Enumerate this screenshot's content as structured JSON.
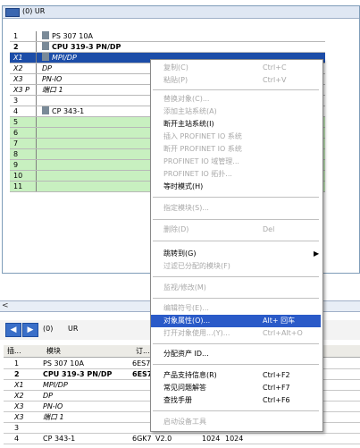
{
  "rack": {
    "title": "(0) UR",
    "rows": [
      {
        "slot": "1",
        "module": "PS 307 10A",
        "style": "normal"
      },
      {
        "slot": "2",
        "module": "CPU 319-3 PN/DP",
        "style": "bold"
      },
      {
        "slot": "X1",
        "module": "MPI/DP",
        "style": "sel"
      },
      {
        "slot": "X2",
        "module": "DP",
        "style": "italic"
      },
      {
        "slot": "X3",
        "module": "PN-IO",
        "style": "italic"
      },
      {
        "slot": "X3 P",
        "module": "端口 1",
        "style": "italic"
      },
      {
        "slot": "3",
        "module": "",
        "style": "normal"
      },
      {
        "slot": "4",
        "module": "CP 343-1",
        "style": "normal"
      },
      {
        "slot": "5",
        "module": "",
        "style": "green"
      },
      {
        "slot": "6",
        "module": "",
        "style": "green"
      },
      {
        "slot": "7",
        "module": "",
        "style": "green"
      },
      {
        "slot": "8",
        "module": "",
        "style": "green"
      },
      {
        "slot": "9",
        "module": "",
        "style": "green"
      },
      {
        "slot": "10",
        "module": "",
        "style": "green"
      },
      {
        "slot": "11",
        "module": "",
        "style": "green"
      }
    ]
  },
  "lower": {
    "title": "(0)",
    "title2": "UR",
    "headers": {
      "slot": "插...",
      "module": "模块",
      "order": "订..."
    },
    "rows": [
      {
        "slot": "1",
        "module": "PS 307 10A",
        "order": "6ES7"
      },
      {
        "slot": "2",
        "module": "CPU 319-3 PN/DP",
        "order": "6ES7"
      },
      {
        "slot": "X1",
        "module": "MPI/DP",
        "order": ""
      },
      {
        "slot": "X2",
        "module": "DP",
        "order": ""
      },
      {
        "slot": "X3",
        "module": "PN-IO",
        "order": ""
      },
      {
        "slot": "X3",
        "module": "端口 1",
        "order": ""
      },
      {
        "slot": "3",
        "module": "",
        "order": ""
      },
      {
        "slot": "4",
        "module": "CP 343-1",
        "order": "6GK7",
        "v": "V2.0",
        "a": "1024",
        "b": "1024"
      }
    ]
  },
  "menu": {
    "items": [
      {
        "label": "复制(C)",
        "shortcut": "Ctrl+C",
        "state": "disabled"
      },
      {
        "label": "粘贴(P)",
        "shortcut": "Ctrl+V",
        "state": "disabled"
      },
      {
        "label": "替换对象(C)...",
        "shortcut": "",
        "state": "disabled"
      },
      {
        "label": "添加主站系统(A)",
        "shortcut": "",
        "state": "disabled"
      },
      {
        "label": "断开主站系统(I)",
        "shortcut": "",
        "state": "enabled"
      },
      {
        "label": "插入 PROFINET IO 系统",
        "shortcut": "",
        "state": "disabled"
      },
      {
        "label": "断开 PROFINET IO 系统",
        "shortcut": "",
        "state": "disabled"
      },
      {
        "label": "PROFINET IO 域管理...",
        "shortcut": "",
        "state": "disabled"
      },
      {
        "label": "PROFINET IO 拓扑...",
        "shortcut": "",
        "state": "disabled"
      },
      {
        "label": "等时模式(H)",
        "shortcut": "",
        "state": "enabled"
      },
      {
        "label": "指定模块(S)...",
        "shortcut": "",
        "state": "disabled"
      },
      {
        "label": "删除(D)",
        "shortcut": "Del",
        "state": "disabled"
      },
      {
        "label": "跳转到(G)",
        "shortcut": "",
        "state": "enabled"
      },
      {
        "label": "过滤已分配的模块(F)",
        "shortcut": "",
        "state": "disabled"
      },
      {
        "label": "监视/修改(M)",
        "shortcut": "",
        "state": "disabled"
      },
      {
        "label": "编辑符号(E)...",
        "shortcut": "",
        "state": "disabled"
      },
      {
        "label": "对象属性(O)...",
        "shortcut": "Alt+ 回车",
        "state": "highlighted"
      },
      {
        "label": "打开对象使用...(Y)...",
        "shortcut": "Ctrl+Alt+O",
        "state": "disabled"
      },
      {
        "label": "分配资产 ID...",
        "shortcut": "",
        "state": "enabled"
      },
      {
        "label": "产品支持信息(R)",
        "shortcut": "Ctrl+F2",
        "state": "enabled"
      },
      {
        "label": "常见问题解答",
        "shortcut": "Ctrl+F7",
        "state": "enabled"
      },
      {
        "label": "查找手册",
        "shortcut": "Ctrl+F6",
        "state": "enabled"
      },
      {
        "label": "启动设备工具",
        "shortcut": "",
        "state": "disabled"
      }
    ],
    "submenu_arrow": "▶"
  },
  "colors": {
    "highlight": "#2a5ac8",
    "empty_slot": "#c8f0c0",
    "selected_row": "#1c4da8"
  }
}
